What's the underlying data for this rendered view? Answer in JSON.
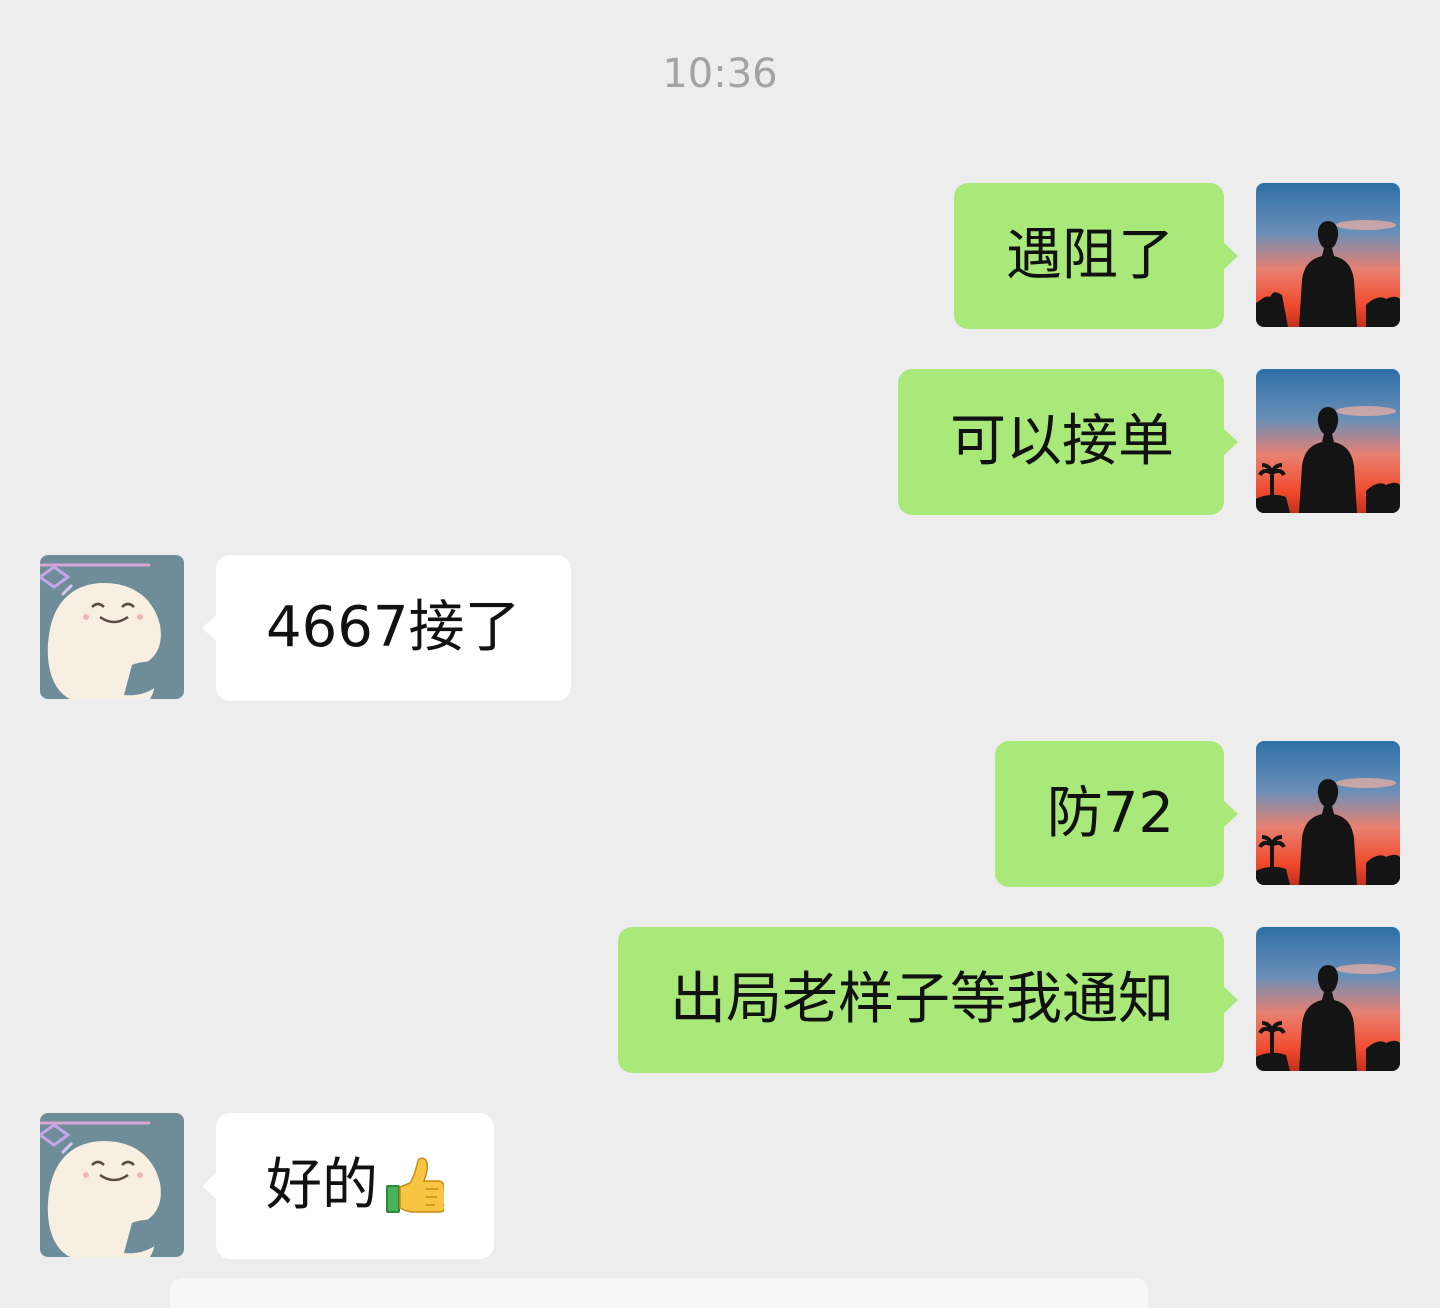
{
  "chat": {
    "timestamp": "10:36",
    "messages": [
      {
        "direction": "out",
        "text": "遇阻了"
      },
      {
        "direction": "out",
        "text": "可以接单"
      },
      {
        "direction": "in",
        "text": "4667接了"
      },
      {
        "direction": "out",
        "text": "防72"
      },
      {
        "direction": "out",
        "text": "出局老样子等我通知"
      },
      {
        "direction": "in",
        "text": "好的",
        "emoji": "thumbs-up"
      }
    ]
  },
  "colors": {
    "background": "#ededed",
    "outgoing_bubble": "#a9e97a",
    "incoming_bubble": "#ffffff",
    "timestamp_text": "#a3a3a3"
  }
}
